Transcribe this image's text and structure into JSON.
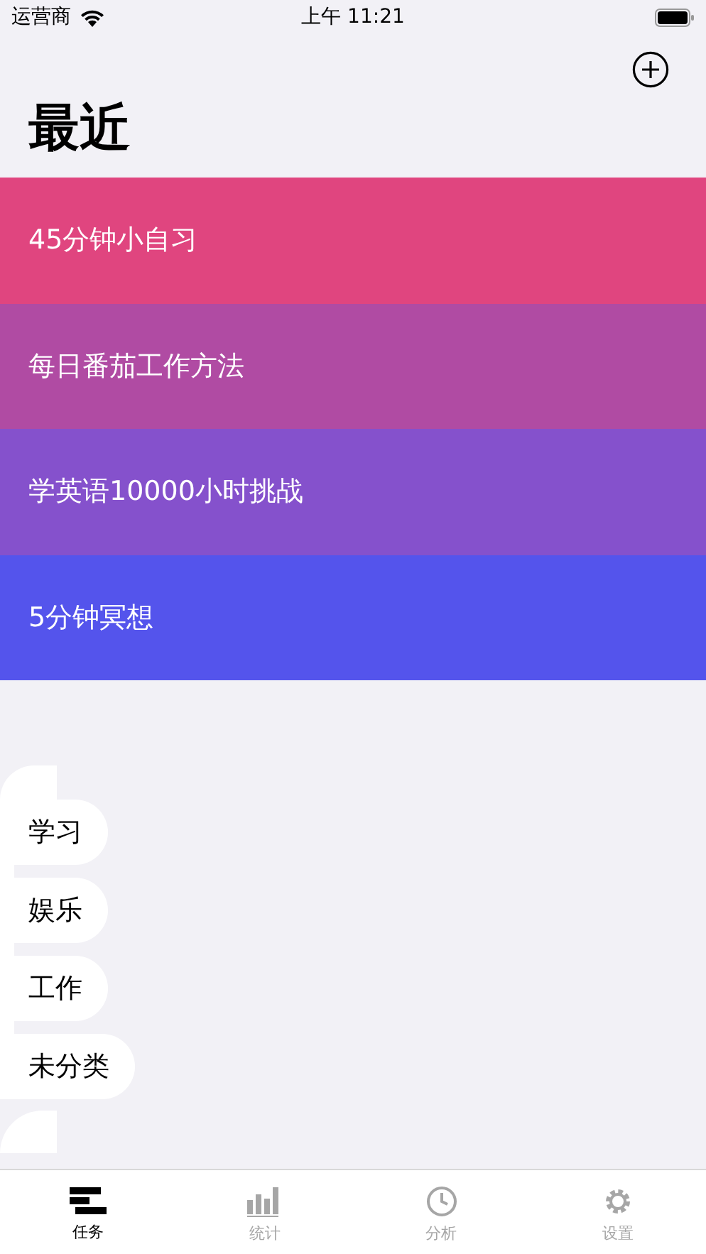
{
  "status_bar": {
    "carrier": "运营商",
    "time": "上午 11:21"
  },
  "title": "最近",
  "recent": [
    {
      "label": "45分钟小自习",
      "color": "#e0457f"
    },
    {
      "label": "每日番茄工作方法",
      "color": "#b04ba3"
    },
    {
      "label": "学英语10000小时挑战",
      "color": "#8551cc"
    },
    {
      "label": "5分钟冥想",
      "color": "#5454ec"
    }
  ],
  "categories": [
    "学习",
    "娱乐",
    "工作",
    "未分类"
  ],
  "tabs": [
    {
      "label": "任务",
      "kind": "list",
      "selected": true
    },
    {
      "label": "统计",
      "kind": "chart",
      "selected": false
    },
    {
      "label": "分析",
      "kind": "timer",
      "selected": false
    },
    {
      "label": "设置",
      "kind": "gear",
      "selected": false
    }
  ]
}
